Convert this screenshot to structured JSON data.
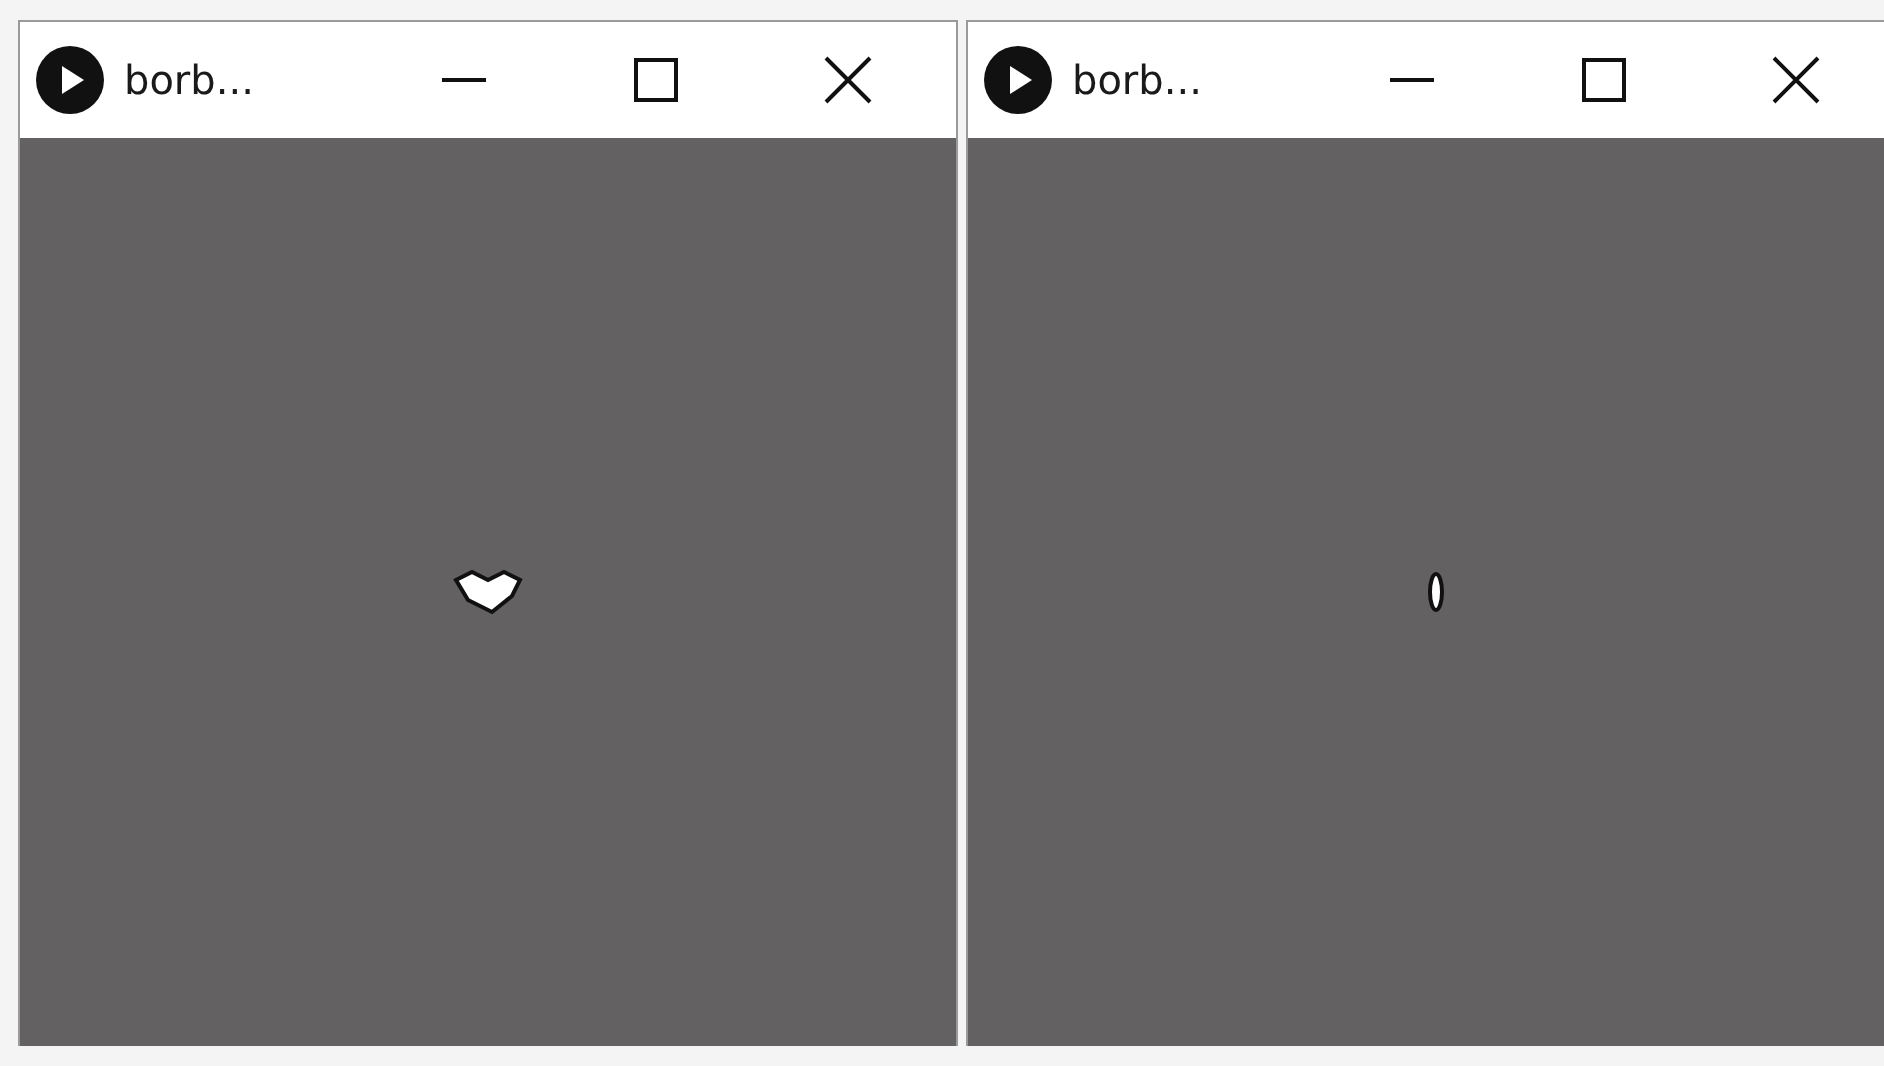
{
  "windows": [
    {
      "title": "borb...",
      "kind": "wide"
    },
    {
      "title": "borb...",
      "kind": "narrow"
    }
  ]
}
